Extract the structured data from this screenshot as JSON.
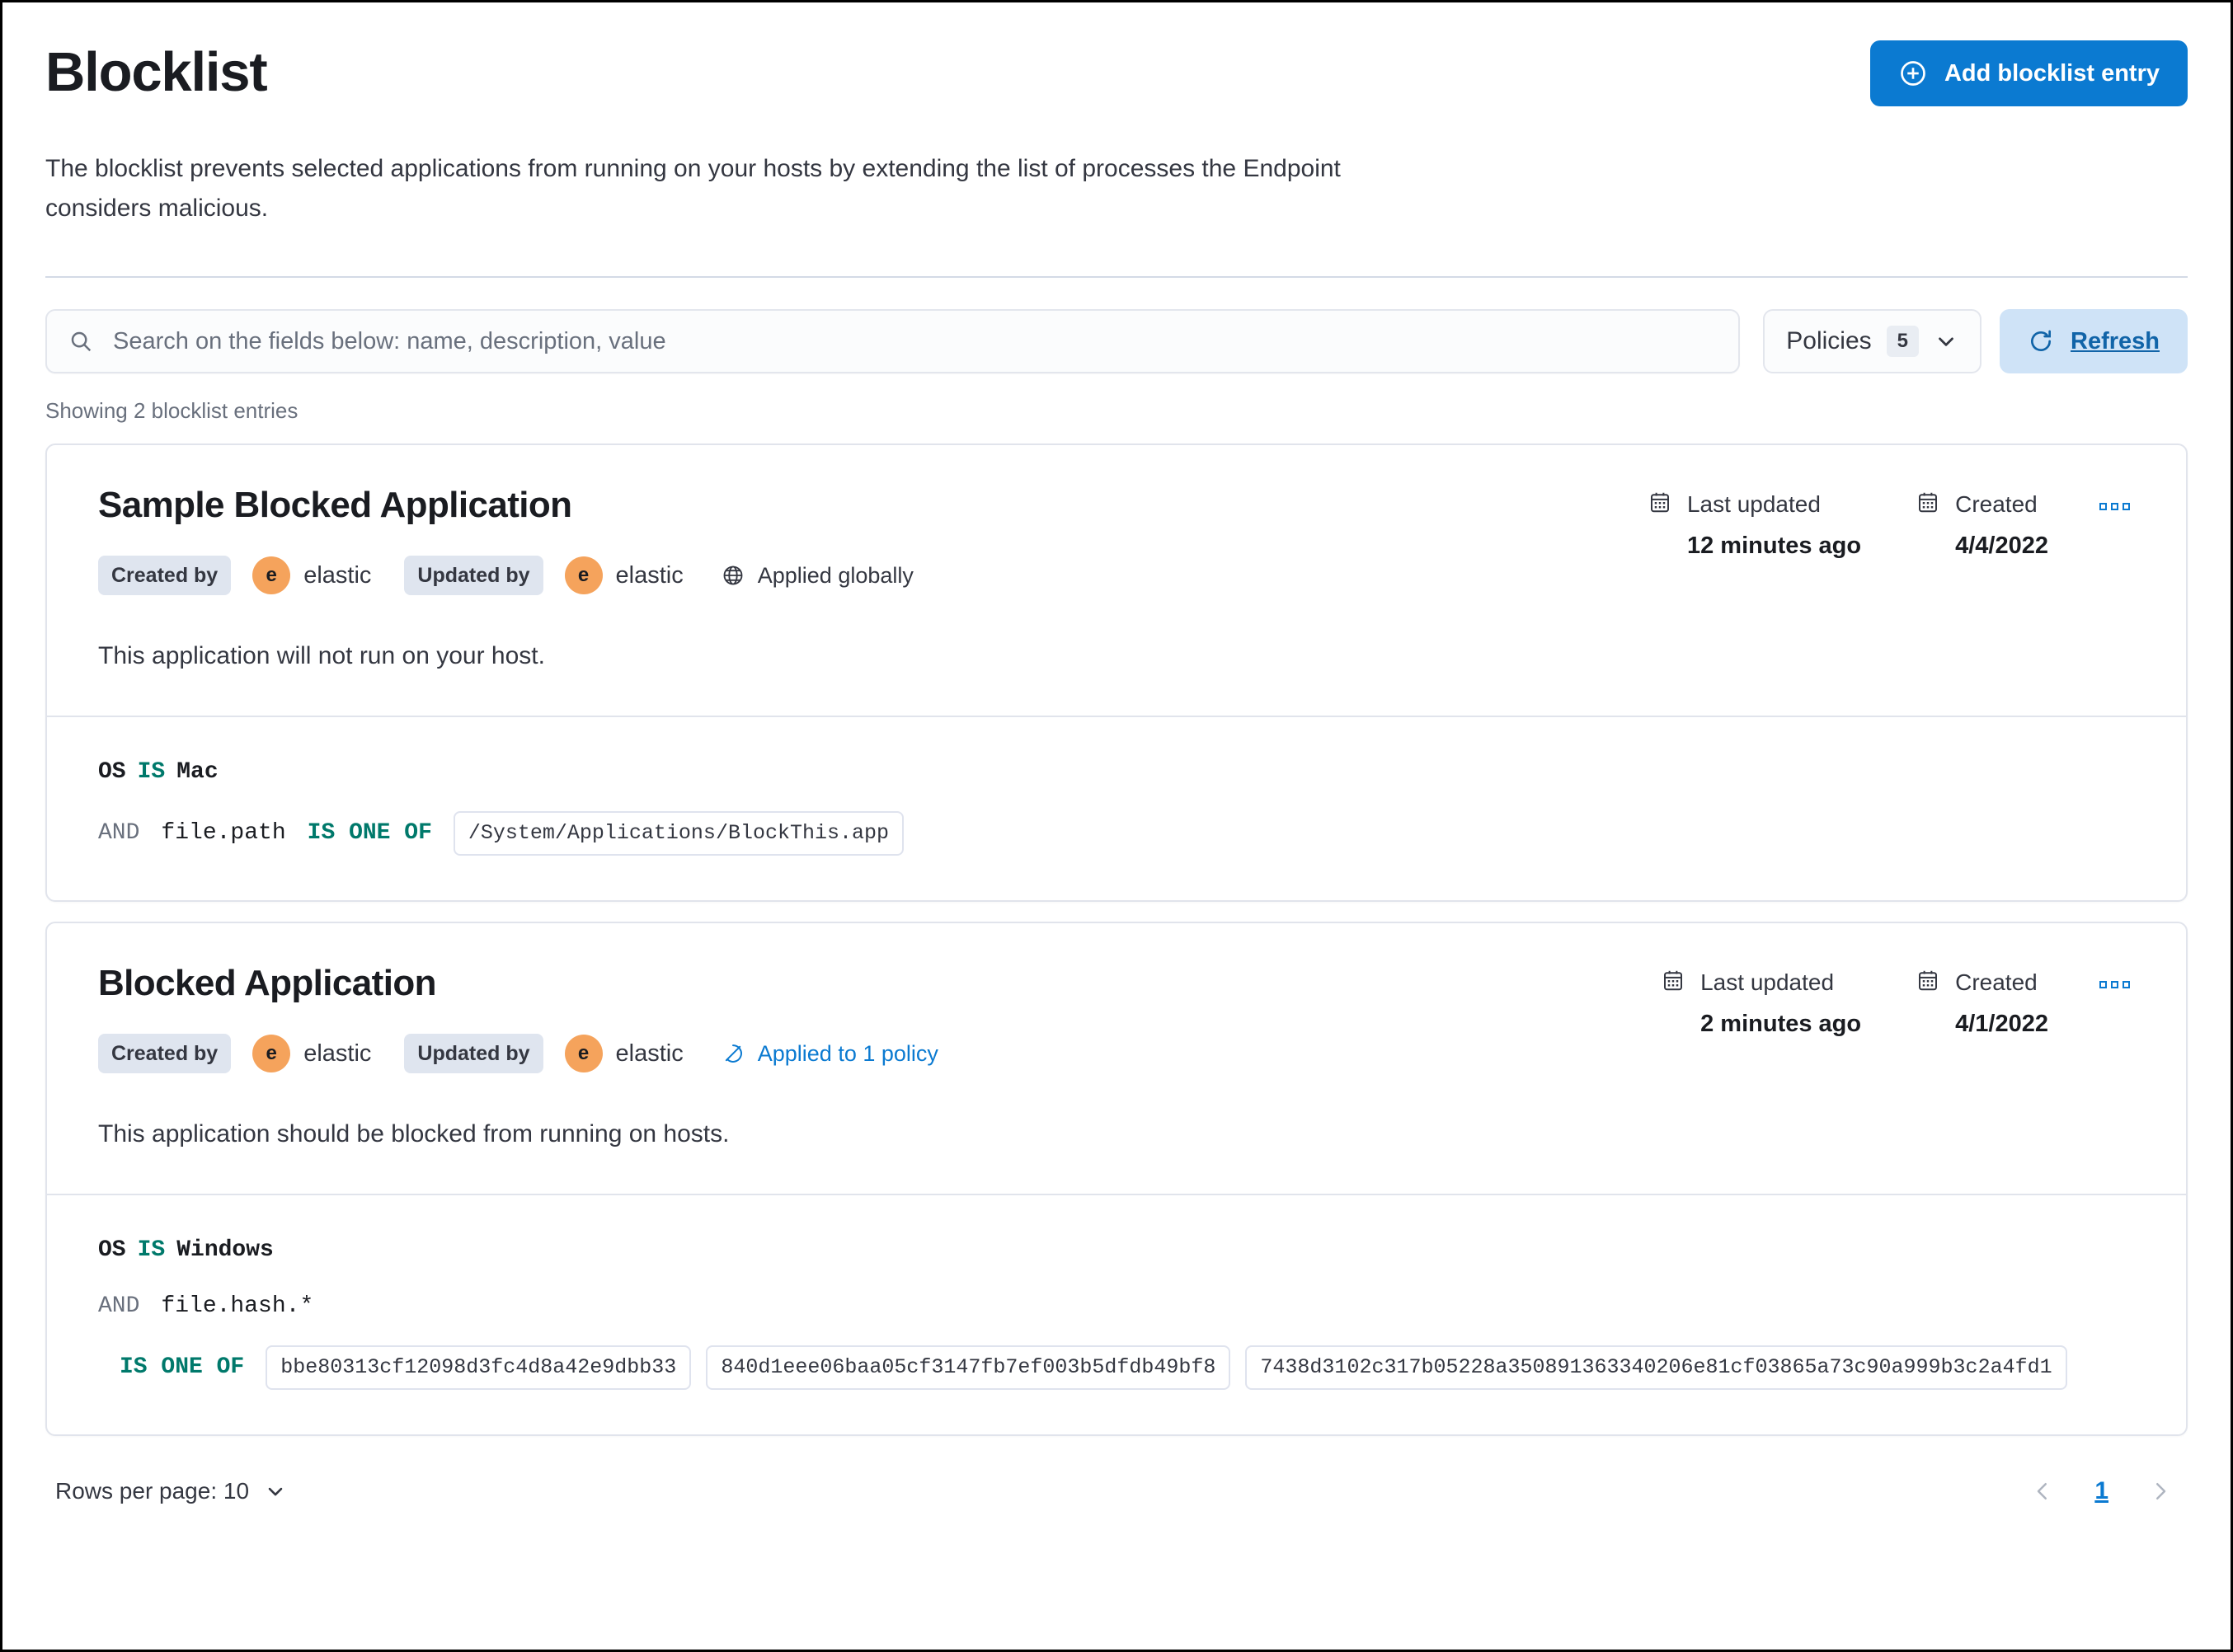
{
  "header": {
    "title": "Blocklist",
    "add_button_label": "Add blocklist entry",
    "description": "The blocklist prevents selected applications from running on your hosts by extending the list of processes the Endpoint considers malicious."
  },
  "search": {
    "placeholder": "Search on the fields below: name, description, value",
    "value": "",
    "policies_label": "Policies",
    "policies_count": "5",
    "refresh_label": "Refresh"
  },
  "summary": {
    "showing_text": "Showing 2 blocklist entries"
  },
  "labels": {
    "created_by": "Created by",
    "updated_by": "Updated by",
    "last_updated": "Last updated",
    "created": "Created",
    "avatar_initial": "e"
  },
  "entries": [
    {
      "name": "Sample Blocked Application",
      "created_by_user": "elastic",
      "updated_by_user": "elastic",
      "applied_text": "Applied globally",
      "applied_is_link": false,
      "last_updated_value": "12 minutes ago",
      "created_value": "4/4/2022",
      "description": "This application will not run on your host.",
      "criteria": {
        "os_field": "OS",
        "os_operator": "IS",
        "os_value": "Mac",
        "conjunction": "AND",
        "field": "file.path",
        "operator": "IS ONE OF",
        "inline_values": true,
        "values": [
          "/System/Applications/BlockThis.app"
        ]
      }
    },
    {
      "name": "Blocked Application",
      "created_by_user": "elastic",
      "updated_by_user": "elastic",
      "applied_text": "Applied to 1 policy",
      "applied_is_link": true,
      "last_updated_value": "2 minutes ago",
      "created_value": "4/1/2022",
      "description": "This application should be blocked from running on hosts.",
      "criteria": {
        "os_field": "OS",
        "os_operator": "IS",
        "os_value": "Windows",
        "conjunction": "AND",
        "field": "file.hash.*",
        "operator": "IS ONE OF",
        "inline_values": false,
        "values": [
          "bbe80313cf12098d3fc4d8a42e9dbb33",
          "840d1eee06baa05cf3147fb7ef003b5dfdb49bf8",
          "7438d3102c317b05228a350891363340206e81cf03865a73c90a999b3c2a4fd1"
        ]
      }
    }
  ],
  "footer": {
    "rows_per_page_label": "Rows per page: 10",
    "current_page": "1"
  },
  "colors": {
    "accent_blue": "#0b7ad1",
    "refresh_bg": "#cfe3f7",
    "avatar_orange": "#f5a35c",
    "operator_teal": "#00796b"
  }
}
